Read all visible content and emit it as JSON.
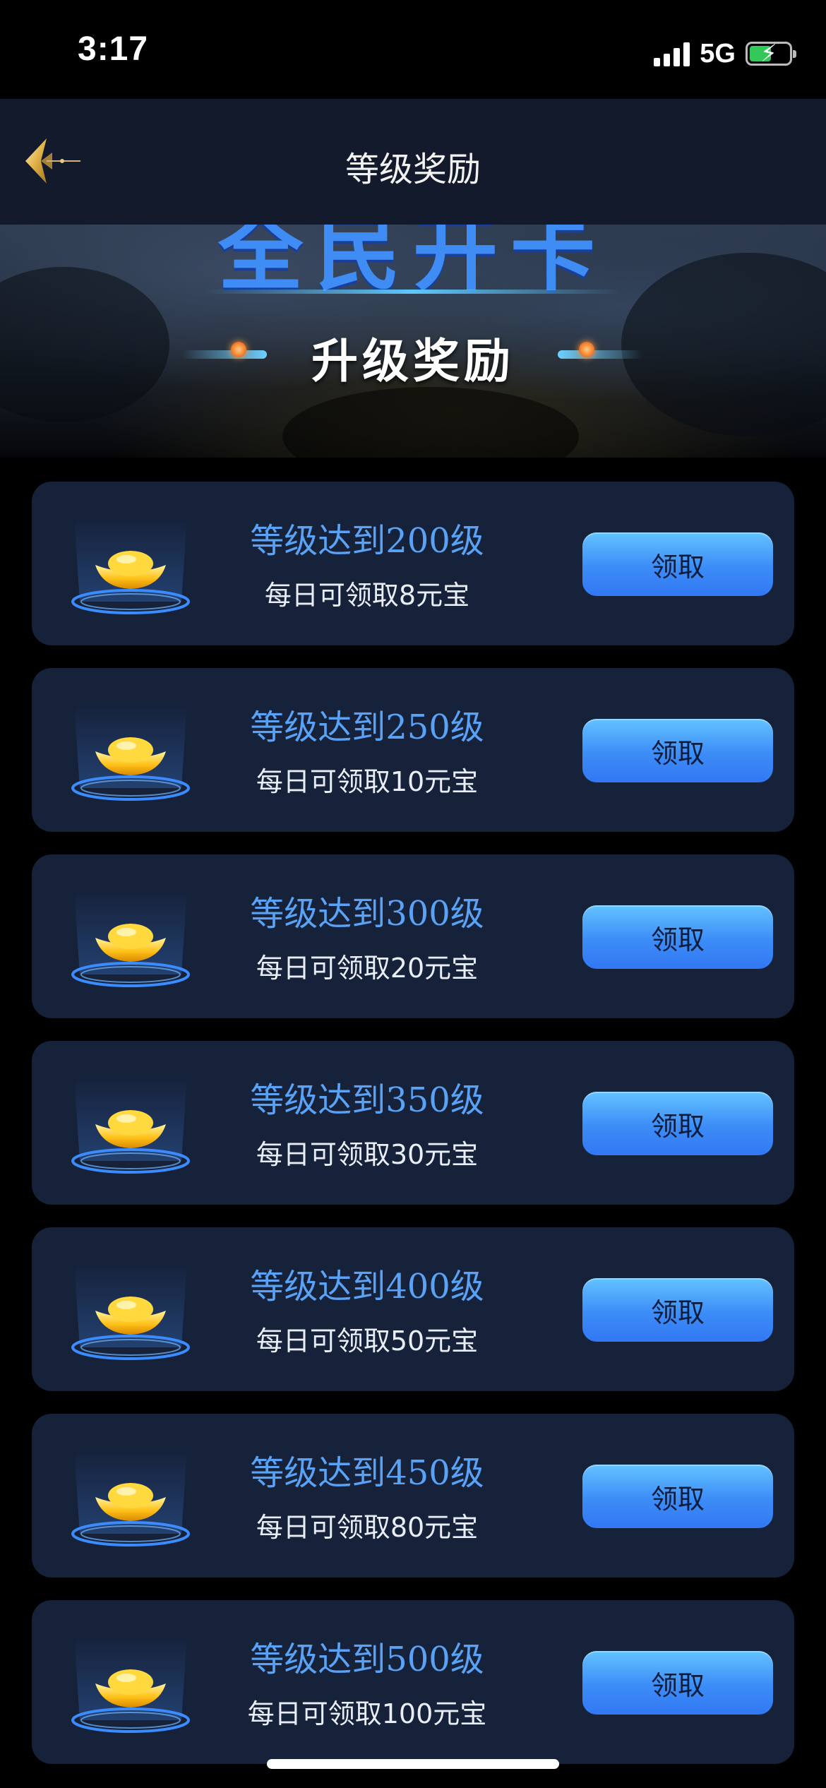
{
  "status_bar": {
    "time": "3:17",
    "network": "5G"
  },
  "nav": {
    "title": "等级奖励"
  },
  "banner": {
    "headline": "全民开卡",
    "subtitle": "升级奖励"
  },
  "rewards": [
    {
      "title": "等级达到200级",
      "desc": "每日可领取8元宝",
      "button": "领取"
    },
    {
      "title": "等级达到250级",
      "desc": "每日可领取10元宝",
      "button": "领取"
    },
    {
      "title": "等级达到300级",
      "desc": "每日可领取20元宝",
      "button": "领取"
    },
    {
      "title": "等级达到350级",
      "desc": "每日可领取30元宝",
      "button": "领取"
    },
    {
      "title": "等级达到400级",
      "desc": "每日可领取50元宝",
      "button": "领取"
    },
    {
      "title": "等级达到450级",
      "desc": "每日可领取80元宝",
      "button": "领取"
    },
    {
      "title": "等级达到500级",
      "desc": "每日可领取100元宝",
      "button": "领取"
    }
  ],
  "icons": {
    "back": "back-chevron-icon",
    "reward": "gold-ingot-icon",
    "signal": "signal-icon",
    "battery": "battery-charging-icon"
  },
  "colors": {
    "accent_blue": "#3f8cf5",
    "card_bg": "#16213a",
    "gold": "#ffc21a"
  }
}
